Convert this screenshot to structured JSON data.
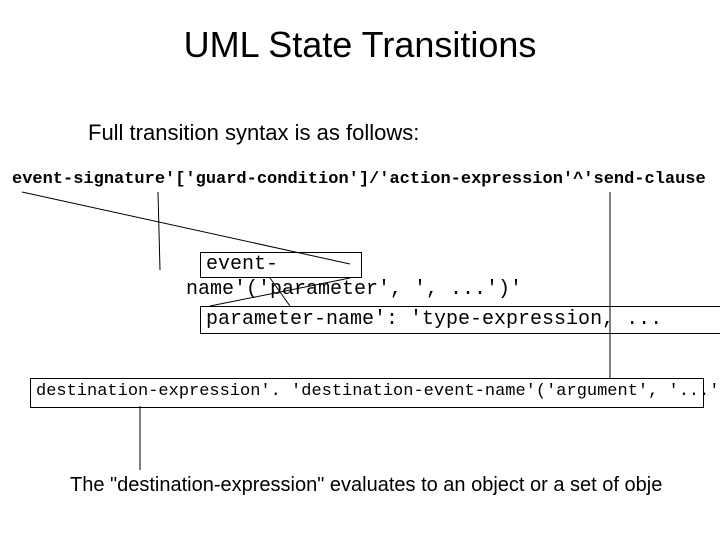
{
  "title": "UML State Transitions",
  "subtitle": "Full transition syntax is as follows:",
  "syntax_line": "event-signature'['guard-condition']/'action-expression'^'send-clause",
  "event_box_line1": "event-",
  "event_box_line2": "name'('parameter', ', ...')'",
  "param_box": "parameter-name': 'type-expression, ...",
  "dest_box": "destination-expression'. 'destination-event-name'('argument', '...')'",
  "bottom_text": "The \"destination-expression\" evaluates to an object or a set of obje"
}
